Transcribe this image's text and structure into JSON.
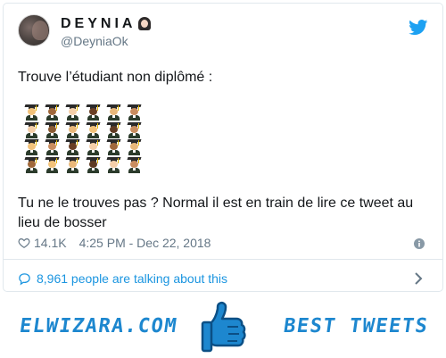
{
  "tweet": {
    "display_name": "DEYNIA",
    "name_emoji": "woman-with-veil-emoji",
    "handle": "@DeyniaOk",
    "text_line1": "Trouve l’étudiant non diplômé :",
    "text_line2": "Tu ne le trouves pas ? Normal il est en train de lire ce tweet au lieu de bosser",
    "likes": "14.1K",
    "timestamp": "4:25 PM - Dec 22, 2018",
    "talking": "8,961 people are talking about this",
    "emoji_grid": {
      "icon": "student-emoji",
      "rows": 4,
      "columns": 6,
      "skin_tones": [
        [
          "#f2c27a",
          "#a0683b",
          "#f5cfa9",
          "#6a3f25",
          "#e9b87a",
          "#c98d5f"
        ],
        [
          "#f5cfa9",
          "#8a5a33",
          "#e9b87a",
          "#f2c27a",
          "#5e3a22",
          "#c98d5f"
        ],
        [
          "#f2c27a",
          "#c98d5f",
          "#6a3f25",
          "#f5cfa9",
          "#a0683b",
          "#e9b87a"
        ],
        [
          "#a0683b",
          "#f2c27a",
          "#e9b87a",
          "#5e3a22",
          "#f5cfa9",
          "#c98d5f"
        ]
      ]
    }
  },
  "icons": {
    "twitter": "twitter-bird-icon",
    "heart": "heart-icon",
    "info": "info-icon",
    "bubble": "speech-bubble-icon",
    "chevron": "chevron-right-icon",
    "thumbs": "thumbs-up-icon"
  },
  "banner": {
    "left_text": "ELWIZARA.COM",
    "right_text": "BEST TWEETS"
  },
  "colors": {
    "text": "#14171a",
    "muted": "#657786",
    "link": "#1b95e0",
    "twitter_blue": "#1da1f2",
    "banner_blue": "#1d87cf",
    "border": "#e1e8ed"
  }
}
